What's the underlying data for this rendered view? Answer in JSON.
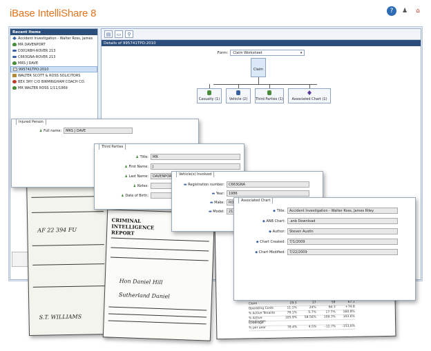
{
  "app": {
    "title": "iBase IntelliShare 8"
  },
  "recent": {
    "header": "Recent Items",
    "items": [
      {
        "label": "Accident Investigation - Walter Ross, James",
        "icon": "case-icon",
        "selected": false
      },
      {
        "label": "MR DAVENPORT",
        "icon": "person-icon",
        "selected": false
      },
      {
        "label": "D301RBH-ROVER 213",
        "icon": "vehicle-icon",
        "selected": false
      },
      {
        "label": "C663GNA-ROVER 213",
        "icon": "vehicle-icon",
        "selected": false
      },
      {
        "label": "MRS J DAVE",
        "icon": "person-icon",
        "selected": false
      },
      {
        "label": "995741TPO:2010",
        "icon": "document-icon",
        "selected": true
      },
      {
        "label": "WALTER SCOTT & ROSS SOLICITORS",
        "icon": "organisation-icon",
        "selected": false
      },
      {
        "label": "BEX 3HY C/O BIRMINGHAM COACH CO.",
        "icon": "location-icon",
        "selected": false
      },
      {
        "label": "MR WALTER ROSS 1/11/1969",
        "icon": "person-icon",
        "selected": false
      }
    ]
  },
  "details": {
    "header": "Details of 995741TPO:2010",
    "form_label": "Form:",
    "form_value": "Claim Worksheet",
    "root_label": "Claim",
    "nodes": [
      "Casualty (1)",
      "Vehicle (2)",
      "Third Parties (1)",
      "Associated Chart (1)"
    ]
  },
  "injured_person": {
    "title": "Injured Person",
    "full_name_label": "Full name:",
    "full_name_value": "MRS J DAVE"
  },
  "third_parties": {
    "title": "Third Parties",
    "fields": [
      {
        "label": "Title:",
        "value": "MR"
      },
      {
        "label": "First Name:",
        "value": "J"
      },
      {
        "label": "Last Name:",
        "value": "DAVENPORT"
      },
      {
        "label": "Notes:",
        "value": ""
      },
      {
        "label": "Date of Birth:",
        "value": ""
      }
    ]
  },
  "vehicles": {
    "title": "Vehicle(s) Involved",
    "fields": [
      {
        "label": "Registration number:",
        "value": "C663GNA"
      },
      {
        "label": "Year:",
        "value": "1986"
      },
      {
        "label": "Make:",
        "value": "RO"
      },
      {
        "label": "Model:",
        "value": "213"
      }
    ]
  },
  "associated_chart": {
    "title": "Associated Chart",
    "fields": [
      {
        "label": "Title:",
        "value": "Accident Investigation - Walter Ross, James Riley"
      },
      {
        "label": "ANB Chart:",
        "value": ".anb Download"
      },
      {
        "label": "Author:",
        "value": "Steven Austin"
      },
      {
        "label": "Chart Created:",
        "value": "7/1/2009"
      },
      {
        "label": "Chart Modified:",
        "value": "7/22/2009"
      }
    ]
  },
  "papers": {
    "report_title": "CRIMINAL INTELLIGENCE REPORT",
    "hand1": "AF 22 394 FU",
    "hand2": "S.T. WILLIAMS",
    "hand3": "Hon Daniel Hill",
    "hand4": "Sutherland Daniel"
  },
  "table": {
    "rows": [
      [
        "Claim",
        "29.3",
        "37",
        "58",
        "67.1"
      ],
      [
        "Operating Costs",
        "11.1%",
        "24%",
        "64.3",
        "+74.8"
      ],
      [
        "% Active Tenants",
        "78.1%",
        "5.7%",
        "17.7%",
        "160.8%"
      ],
      [
        "% Active Employees",
        "105.9%",
        "58.56%",
        "109.3%",
        "103.6%"
      ],
      [
        "Coverage",
        "",
        "",
        "",
        ""
      ],
      [
        "% per year",
        "78.4%",
        "4.5%",
        "-12.7%",
        "-153.6%"
      ]
    ]
  },
  "colors": {
    "accent": "#e2731c",
    "header": "#2c4e7c"
  }
}
